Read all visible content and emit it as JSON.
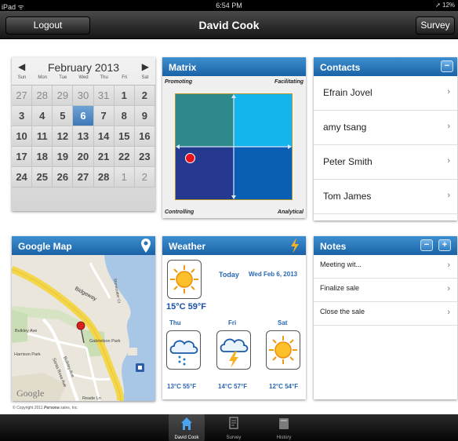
{
  "status_bar": {
    "device": "iPad ᯤ",
    "time": "6:54 PM",
    "battery": "➚ 12%"
  },
  "navbar": {
    "left_button": "Logout",
    "title": "David Cook",
    "right_button": "Survey"
  },
  "calendar": {
    "month": "February 2013",
    "weekdays": [
      "Sun",
      "Mon",
      "Tue",
      "Wed",
      "Thu",
      "Fri",
      "Sat"
    ],
    "days": [
      {
        "d": "27",
        "dim": true
      },
      {
        "d": "28",
        "dim": true
      },
      {
        "d": "29",
        "dim": true
      },
      {
        "d": "30",
        "dim": true
      },
      {
        "d": "31",
        "dim": true
      },
      {
        "d": "1"
      },
      {
        "d": "2"
      },
      {
        "d": "3"
      },
      {
        "d": "4"
      },
      {
        "d": "5"
      },
      {
        "d": "6",
        "selected": true
      },
      {
        "d": "7"
      },
      {
        "d": "8"
      },
      {
        "d": "9"
      },
      {
        "d": "10"
      },
      {
        "d": "11"
      },
      {
        "d": "12"
      },
      {
        "d": "13"
      },
      {
        "d": "14"
      },
      {
        "d": "15"
      },
      {
        "d": "16"
      },
      {
        "d": "17"
      },
      {
        "d": "18"
      },
      {
        "d": "19"
      },
      {
        "d": "20"
      },
      {
        "d": "21"
      },
      {
        "d": "22"
      },
      {
        "d": "23"
      },
      {
        "d": "24"
      },
      {
        "d": "25"
      },
      {
        "d": "26"
      },
      {
        "d": "27"
      },
      {
        "d": "28"
      },
      {
        "d": "1",
        "dim": true
      },
      {
        "d": "2",
        "dim": true
      }
    ]
  },
  "matrix": {
    "title": "Matrix",
    "top_left": "Promoting",
    "top_right": "Facilitating",
    "bottom_left": "Controlling",
    "bottom_right": "Analytical",
    "colors": {
      "tl": "#2e8a8a",
      "tr": "#14b4ec",
      "bl": "#24388f",
      "br": "#0a5fb4",
      "marker": "#e8121e"
    }
  },
  "contacts": {
    "title": "Contacts",
    "collapse": "−",
    "items": [
      "Efrain Jovel",
      "amy tsang",
      "Peter Smith",
      "Tom James"
    ]
  },
  "google_map": {
    "title": "Google Map",
    "logo": "Google",
    "streets": [
      "Bidgeway",
      "Bulkley Ave",
      "Harrison Park",
      "Gabrielson Park",
      "Santa Rosa Ave",
      "Bulkley Ave",
      "Reade Ln",
      "Stonecutter Ct"
    ]
  },
  "weather": {
    "title": "Weather",
    "today_label": "Today",
    "today_date": "Wed Feb 6, 2013",
    "today_temp": "15°C 59°F",
    "forecast": [
      {
        "day": "Thu",
        "icon": "rain-cloud-icon",
        "temp": "13°C 55°F"
      },
      {
        "day": "Fri",
        "icon": "storm-cloud-icon",
        "temp": "14°C 57°F"
      },
      {
        "day": "Sat",
        "icon": "sun-icon",
        "temp": "12°C 54°F"
      }
    ]
  },
  "notes": {
    "title": "Notes",
    "minus": "−",
    "plus": "+",
    "items": [
      "Meeting wit...",
      "Finalize sale",
      "Close the sale"
    ]
  },
  "copyright": {
    "prefix": "© Copyright 2011 ",
    "brand": "Persona",
    "suffix": " sales, Inc."
  },
  "tabs": [
    {
      "label": "David Cook",
      "icon": "home-icon",
      "active": true
    },
    {
      "label": "Survey",
      "icon": "survey-icon",
      "active": false
    },
    {
      "label": "History",
      "icon": "history-icon",
      "active": false
    }
  ],
  "chevron": "›"
}
